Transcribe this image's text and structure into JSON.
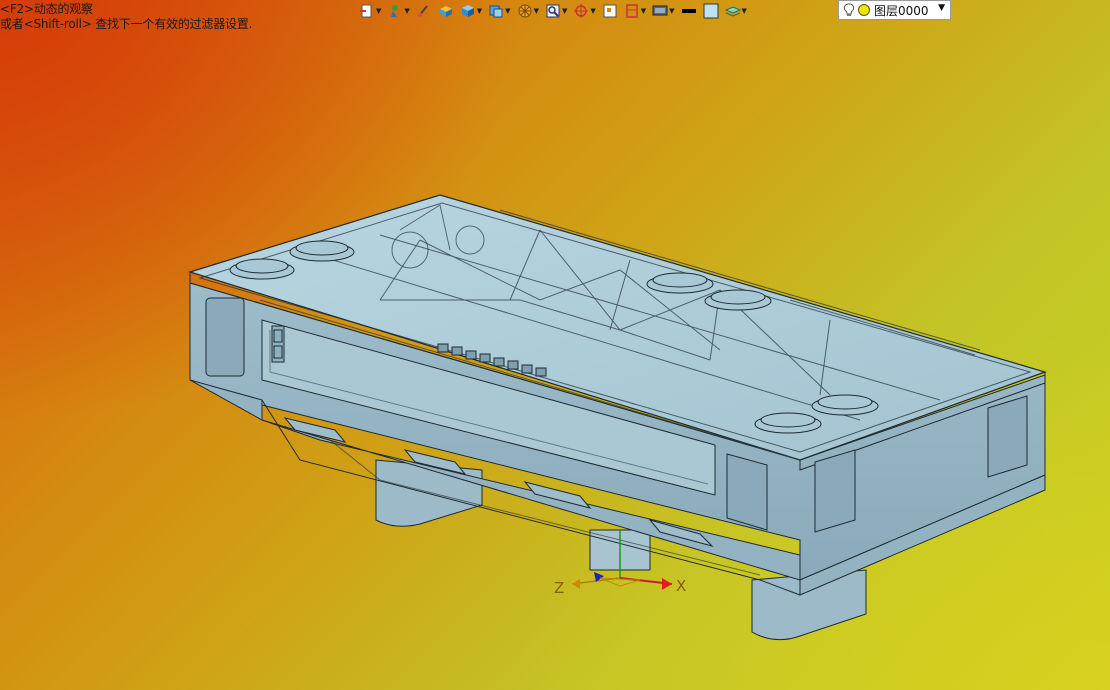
{
  "prompt": {
    "line1": "<F2>动态的观察",
    "line2": "或者<Shift-roll> 查找下一个有效的过滤器设置."
  },
  "toolbar": {
    "icons": [
      "new-document-icon",
      "paint-icon",
      "brush-icon",
      "shade-icon",
      "cube-icon",
      "view-cube-icon",
      "wheel-icon",
      "zoom-icon",
      "target-icon",
      "frame-icon",
      "section-icon",
      "display-icon",
      "line-color-icon",
      "face-color-icon",
      "layer-stack-icon"
    ]
  },
  "layer": {
    "name": "图层0000",
    "bulb_icon": "lightbulb-icon",
    "status_color": "#f2e300"
  },
  "axes": {
    "x_label": "X",
    "z_label": "Z"
  },
  "colors": {
    "model_fill": "#a8c6d2",
    "model_edge": "#1f2a30",
    "bg_orange": "#d65a0c",
    "bg_yellow": "#c8d422"
  }
}
